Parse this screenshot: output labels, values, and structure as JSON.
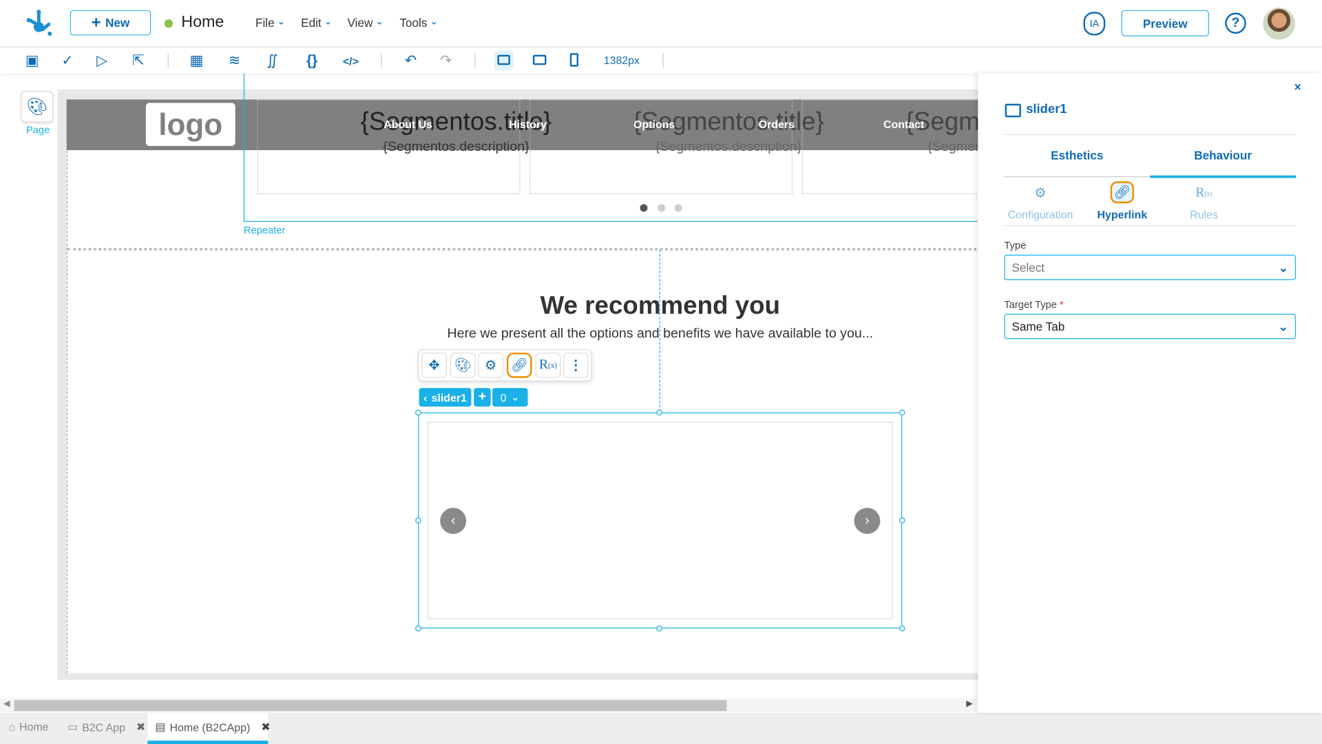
{
  "header": {
    "new_label": "New",
    "page_name": "Home",
    "status_color": "#8bc34a",
    "menus": [
      "File",
      "Edit",
      "View",
      "Tools"
    ],
    "ia_label": "IA",
    "preview_label": "Preview"
  },
  "toolbar": {
    "width_readout": "1382px"
  },
  "left": {
    "page_label": "Page"
  },
  "canvas": {
    "logo_text": "logo",
    "segment_title": "{Segmentos.title}",
    "segment_description": "{Segmentos.description}",
    "nav": [
      "About Us",
      "History",
      "Options",
      "Orders",
      "Contact"
    ],
    "repeater_label": "Repeater",
    "heading": "We recommend you",
    "subheading": "Here we present all the options and benefits we have available to you...",
    "slider_tag": "slider1",
    "slider_index": "0"
  },
  "panel": {
    "title": "slider1",
    "tabs": [
      "Esthetics",
      "Behaviour"
    ],
    "active_tab": "Behaviour",
    "subtabs": [
      "Configuration",
      "Hyperlink",
      "Rules"
    ],
    "active_subtab": "Hyperlink",
    "type_label": "Type",
    "type_value": "Select",
    "target_label": "Target Type",
    "target_required": "*",
    "target_value": "Same Tab"
  },
  "bottom_tabs": [
    {
      "label": "Home"
    },
    {
      "label": "B2C App"
    },
    {
      "label": "Home (B2CApp)",
      "active": true
    }
  ],
  "colors": {
    "accent": "#1ab0e8",
    "primary": "#0e6bb5",
    "highlight": "#f08c00"
  }
}
